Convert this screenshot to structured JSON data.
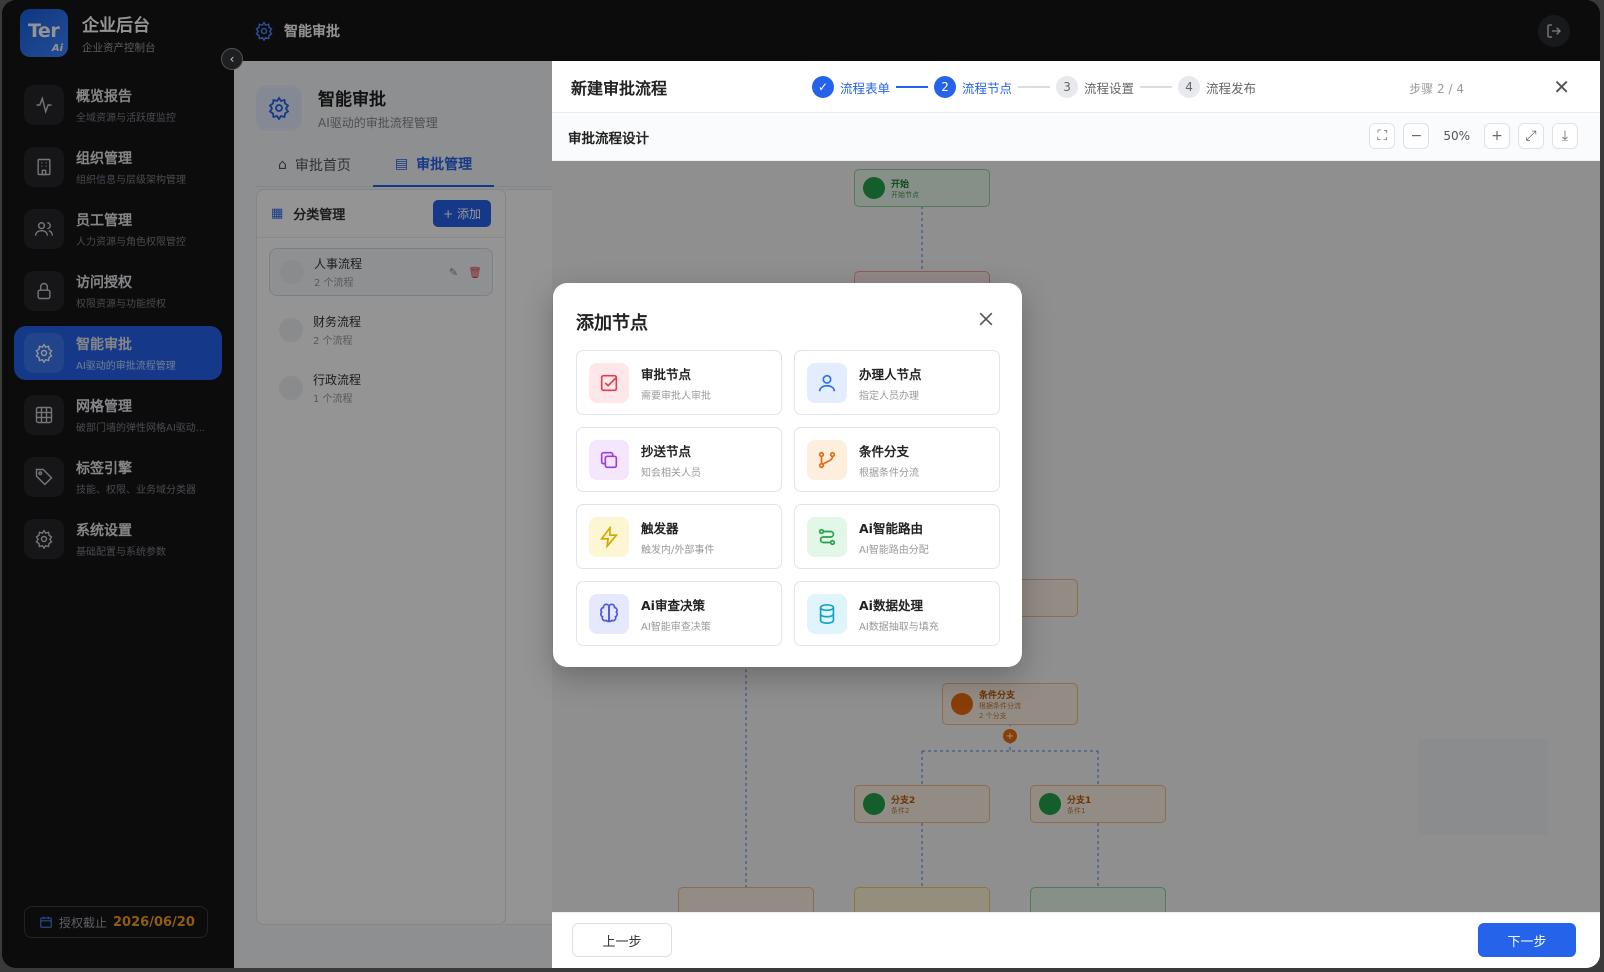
{
  "brand": {
    "logo_text": "Ter",
    "logo_sub": "Ai",
    "title": "企业后台",
    "subtitle": "企业资产控制台"
  },
  "topbar": {
    "title": "智能审批"
  },
  "sidebar": {
    "items": [
      {
        "label": "概览报告",
        "desc": "全域资源与活跃度监控",
        "icon": "activity-icon"
      },
      {
        "label": "组织管理",
        "desc": "组织信息与层级架构管理",
        "icon": "building-icon"
      },
      {
        "label": "员工管理",
        "desc": "人力资源与角色权限管控",
        "icon": "users-icon"
      },
      {
        "label": "访问授权",
        "desc": "权限资源与功能授权",
        "icon": "lock-icon"
      },
      {
        "label": "智能审批",
        "desc": "AI驱动的审批流程管理",
        "icon": "gear-icon",
        "active": true
      },
      {
        "label": "网格管理",
        "desc": "破部门墙的弹性网格AI驱动...",
        "icon": "grid-icon"
      },
      {
        "label": "标签引擎",
        "desc": "技能、权限、业务域分类器",
        "icon": "tag-icon"
      },
      {
        "label": "系统设置",
        "desc": "基础配置与系统参数",
        "icon": "settings-icon"
      }
    ],
    "license_label": "授权截止",
    "license_date": "2026/06/20"
  },
  "page": {
    "title": "智能审批",
    "subtitle": "AI驱动的审批流程管理",
    "tabs": [
      "审批首页",
      "审批管理"
    ],
    "category_title": "分类管理",
    "add_label": "+ 添加",
    "categories": [
      {
        "name": "人事流程",
        "count": "2 个流程"
      },
      {
        "name": "财务流程",
        "count": "2 个流程"
      },
      {
        "name": "行政流程",
        "count": "1 个流程"
      }
    ]
  },
  "drawer": {
    "title": "新建审批流程",
    "steps": [
      {
        "num": "✓",
        "label": "流程表单"
      },
      {
        "num": "2",
        "label": "流程节点"
      },
      {
        "num": "3",
        "label": "流程设置"
      },
      {
        "num": "4",
        "label": "流程发布"
      }
    ],
    "step_count": "步骤 2 / 4",
    "canvas_title": "审批流程设计",
    "zoom": "50%",
    "prev_label": "上一步",
    "next_label": "下一步",
    "nodes": {
      "start": {
        "title": "开始",
        "sub": "开始节点"
      },
      "cond": {
        "title": "条件分支",
        "sub": "根据条件分流",
        "extra": "2 个分支"
      },
      "branch2": {
        "title": "分支2",
        "sub": "条件2"
      },
      "branch1": {
        "title": "分支1",
        "sub": "条件1"
      }
    }
  },
  "modal": {
    "title": "添加节点",
    "cards": [
      {
        "label": "审批节点",
        "desc": "需要审批人审批",
        "icon": "check-square-icon",
        "bg": "#fde7ea",
        "color": "#e23d4b"
      },
      {
        "label": "办理人节点",
        "desc": "指定人员办理",
        "icon": "user-icon",
        "bg": "#e3edfd",
        "color": "#2f6fe4"
      },
      {
        "label": "抄送节点",
        "desc": "知会相关人员",
        "icon": "copy-icon",
        "bg": "#f3e6fd",
        "color": "#9b3de0"
      },
      {
        "label": "条件分支",
        "desc": "根据条件分流",
        "icon": "branch-icon",
        "bg": "#fdeedd",
        "color": "#e26a12"
      },
      {
        "label": "触发器",
        "desc": "触发内/外部事件",
        "icon": "bolt-icon",
        "bg": "#fdf6d2",
        "color": "#d6a300"
      },
      {
        "label": "Ai智能路由",
        "desc": "AI智能路由分配",
        "icon": "route-icon",
        "bg": "#e2f7e8",
        "color": "#22a24a"
      },
      {
        "label": "Ai审查决策",
        "desc": "AI智能审查决策",
        "icon": "brain-icon",
        "bg": "#e6e9fd",
        "color": "#5058e0"
      },
      {
        "label": "Ai数据处理",
        "desc": "AI数据抽取与填充",
        "icon": "database-icon",
        "bg": "#dff5fb",
        "color": "#0fa3c4"
      }
    ]
  }
}
